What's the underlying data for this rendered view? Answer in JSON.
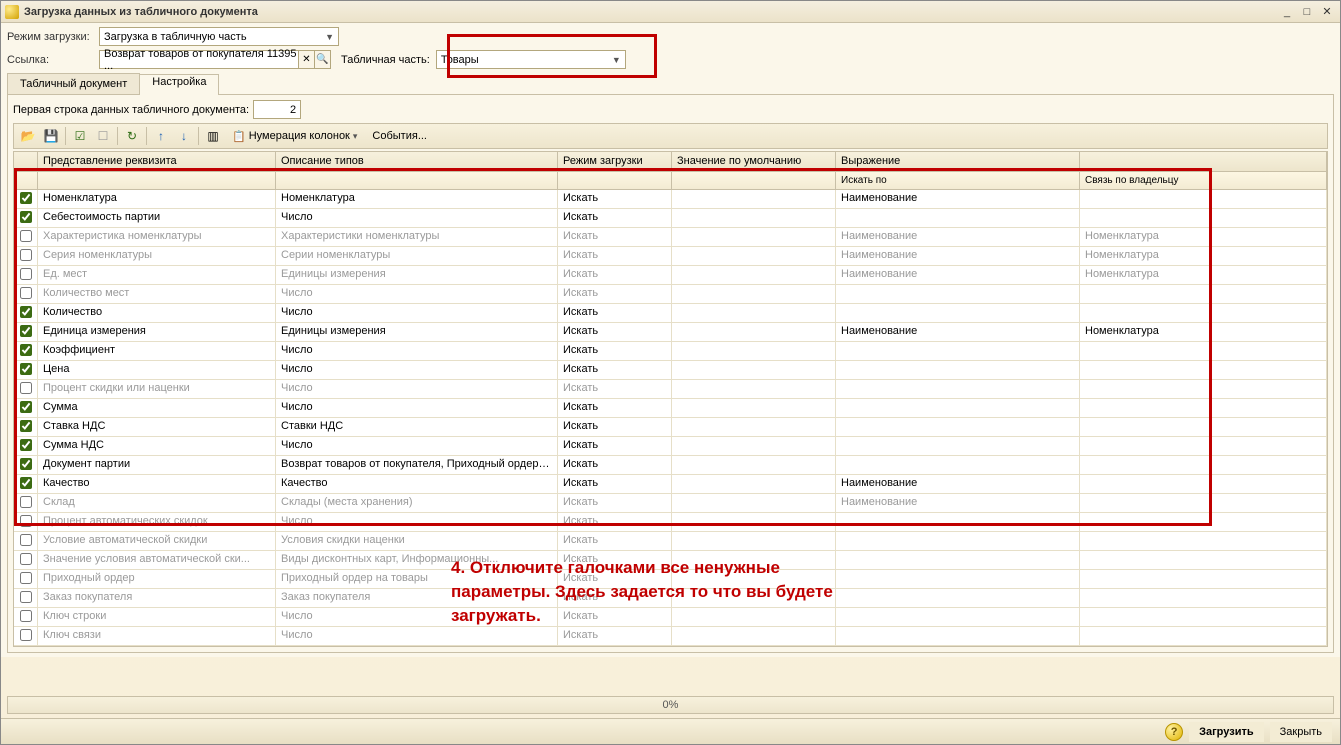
{
  "window": {
    "title": "Загрузка данных из табличного документа"
  },
  "form": {
    "mode_label": "Режим загрузки:",
    "mode_value": "Загрузка в табличную часть",
    "link_label": "Ссылка:",
    "link_value": "Возврат товаров от покупателя 11395 ...",
    "tabpart_label": "Табличная часть:",
    "tabpart_value": "Товары"
  },
  "tabs": {
    "t0": "Табличный документ",
    "t1": "Настройка"
  },
  "subform": {
    "firstrow_label": "Первая строка данных табличного документа:",
    "firstrow_value": "2"
  },
  "toolbar": {
    "numbering": "Нумерация колонок",
    "events": "События..."
  },
  "grid_headers": {
    "name": "Представление реквизита",
    "type": "Описание типов",
    "mode": "Режим загрузки",
    "default": "Значение по умолчанию",
    "expr": "Выражение",
    "sub_search": "Искать по",
    "sub_link": "Связь по владельцу"
  },
  "rows": [
    {
      "chk": true,
      "dis": false,
      "name": "Номенклатура",
      "type": "Номенклатура",
      "mode": "Искать",
      "expr": "Наименование",
      "link": ""
    },
    {
      "chk": true,
      "dis": false,
      "name": "Себестоимость партии",
      "type": "Число",
      "mode": "Искать",
      "expr": "",
      "link": ""
    },
    {
      "chk": false,
      "dis": true,
      "name": "Характеристика номенклатуры",
      "type": "Характеристики номенклатуры",
      "mode": "Искать",
      "expr": "Наименование",
      "link": "Номенклатура"
    },
    {
      "chk": false,
      "dis": true,
      "name": "Серия номенклатуры",
      "type": "Серии номенклатуры",
      "mode": "Искать",
      "expr": "Наименование",
      "link": "Номенклатура"
    },
    {
      "chk": false,
      "dis": true,
      "name": "Ед. мест",
      "type": "Единицы измерения",
      "mode": "Искать",
      "expr": "Наименование",
      "link": "Номенклатура"
    },
    {
      "chk": false,
      "dis": true,
      "name": "Количество мест",
      "type": "Число",
      "mode": "Искать",
      "expr": "",
      "link": ""
    },
    {
      "chk": true,
      "dis": false,
      "name": "Количество",
      "type": "Число",
      "mode": "Искать",
      "expr": "",
      "link": ""
    },
    {
      "chk": true,
      "dis": false,
      "name": "Единица измерения",
      "type": "Единицы измерения",
      "mode": "Искать",
      "expr": "Наименование",
      "link": "Номенклатура"
    },
    {
      "chk": true,
      "dis": false,
      "name": "Коэффициент",
      "type": "Число",
      "mode": "Искать",
      "expr": "",
      "link": ""
    },
    {
      "chk": true,
      "dis": false,
      "name": "Цена",
      "type": "Число",
      "mode": "Искать",
      "expr": "",
      "link": ""
    },
    {
      "chk": false,
      "dis": true,
      "name": "Процент скидки или наценки",
      "type": "Число",
      "mode": "Искать",
      "expr": "",
      "link": ""
    },
    {
      "chk": true,
      "dis": false,
      "name": "Сумма",
      "type": "Число",
      "mode": "Искать",
      "expr": "",
      "link": ""
    },
    {
      "chk": true,
      "dis": false,
      "name": "Ставка НДС",
      "type": "Ставки НДС",
      "mode": "Искать",
      "expr": "",
      "link": ""
    },
    {
      "chk": true,
      "dis": false,
      "name": "Сумма НДС",
      "type": "Число",
      "mode": "Искать",
      "expr": "",
      "link": ""
    },
    {
      "chk": true,
      "dis": false,
      "name": "Документ партии",
      "type": "Возврат товаров от покупателя, Приходный ордер н...",
      "mode": "Искать",
      "expr": "",
      "link": ""
    },
    {
      "chk": true,
      "dis": false,
      "name": "Качество",
      "type": "Качество",
      "mode": "Искать",
      "expr": "Наименование",
      "link": ""
    },
    {
      "chk": false,
      "dis": true,
      "name": "Склад",
      "type": "Склады (места хранения)",
      "mode": "Искать",
      "expr": "Наименование",
      "link": ""
    },
    {
      "chk": false,
      "dis": true,
      "name": "Процент автоматических скидок",
      "type": "Число",
      "mode": "Искать",
      "expr": "",
      "link": ""
    },
    {
      "chk": false,
      "dis": true,
      "name": "Условие автоматической скидки",
      "type": "Условия скидки наценки",
      "mode": "Искать",
      "expr": "",
      "link": ""
    },
    {
      "chk": false,
      "dis": true,
      "name": "Значение условия автоматической ски...",
      "type": "Виды дисконтных карт, Информационны...",
      "mode": "Искать",
      "expr": "",
      "link": ""
    },
    {
      "chk": false,
      "dis": true,
      "name": "Приходный ордер",
      "type": "Приходный ордер на товары",
      "mode": "Искать",
      "expr": "",
      "link": ""
    },
    {
      "chk": false,
      "dis": true,
      "name": "Заказ покупателя",
      "type": "Заказ покупателя",
      "mode": "Искать",
      "expr": "",
      "link": ""
    },
    {
      "chk": false,
      "dis": true,
      "name": "Ключ строки",
      "type": "Число",
      "mode": "Искать",
      "expr": "",
      "link": ""
    },
    {
      "chk": false,
      "dis": true,
      "name": "Ключ связи",
      "type": "Число",
      "mode": "Искать",
      "expr": "",
      "link": ""
    }
  ],
  "status": {
    "progress": "0%"
  },
  "footer": {
    "load": "Загрузить",
    "close": "Закрыть"
  },
  "annotation": "4. Отключите галочками все ненужные параметры. Здесь задается то что вы будете загружать."
}
